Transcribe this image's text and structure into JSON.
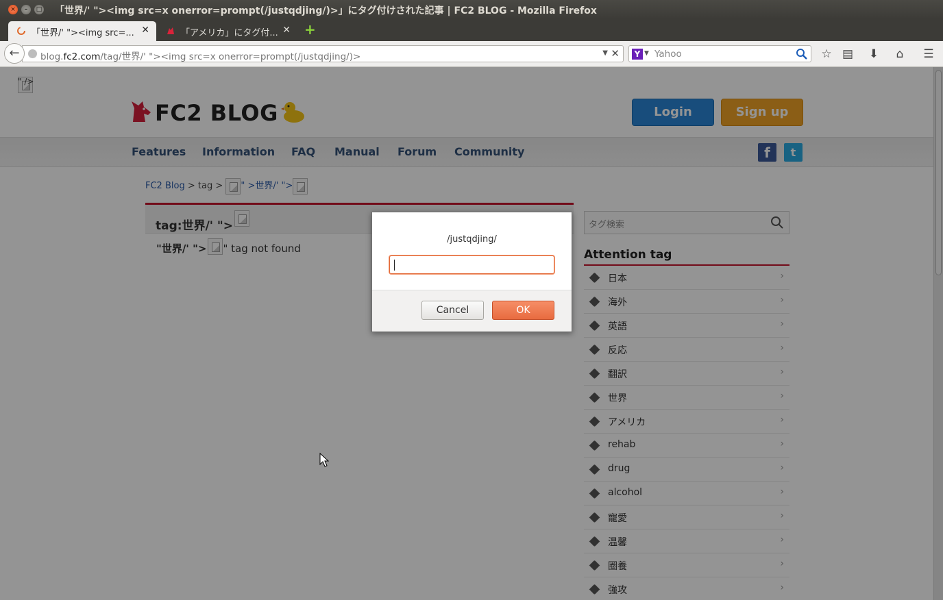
{
  "window": {
    "title": "「世界/' \"><img src=x onerror=prompt(/justqdjing/)>」にタグ付けされた記事 | FC2 BLOG - Mozilla Firefox"
  },
  "tabs": [
    {
      "label": "「世界/' \"><img src=...",
      "active": true
    },
    {
      "label": "「アメリカ」にタグ付...",
      "active": false
    }
  ],
  "toolbar": {
    "url_prefix": "blog.",
    "url_domain": "fc2.com",
    "url_path": "/tag/世界/' \"><img src=x onerror=prompt(/justqdjing/)>",
    "search_placeholder": "Yahoo"
  },
  "page": {
    "top_fragment": "\" />",
    "logo_text": "FC2 BLOG",
    "login_label": "Login",
    "signup_label": "Sign up",
    "nav": [
      "Features",
      "Information",
      "FAQ",
      "Manual",
      "Forum",
      "Community"
    ],
    "breadcrumb": {
      "home": "FC2 Blog",
      "sep1": ">",
      "tag": "tag",
      "sep2": ">",
      "frag1": "\" >世界/' \">"
    },
    "tag_heading": "tag:世界/' \">",
    "not_found_prefix": "\"世界/' \">",
    "not_found_suffix": "\" tag not found",
    "tag_search_placeholder": "タグ検索",
    "attention_title": "Attention tag",
    "attention_tags": [
      "日本",
      "海外",
      "英語",
      "反応",
      "翻訳",
      "世界",
      "アメリカ",
      "rehab",
      "drug",
      "alcohol",
      "寵愛",
      "温馨",
      "圈養",
      "強攻"
    ]
  },
  "dialog": {
    "message": "/justqdjing/",
    "input_value": "",
    "cancel_label": "Cancel",
    "ok_label": "OK"
  },
  "colors": {
    "accent_red": "#c4142c",
    "login_blue": "#2a86d6",
    "signup_orange": "#f0a327",
    "ok_orange": "#e86b3f"
  }
}
